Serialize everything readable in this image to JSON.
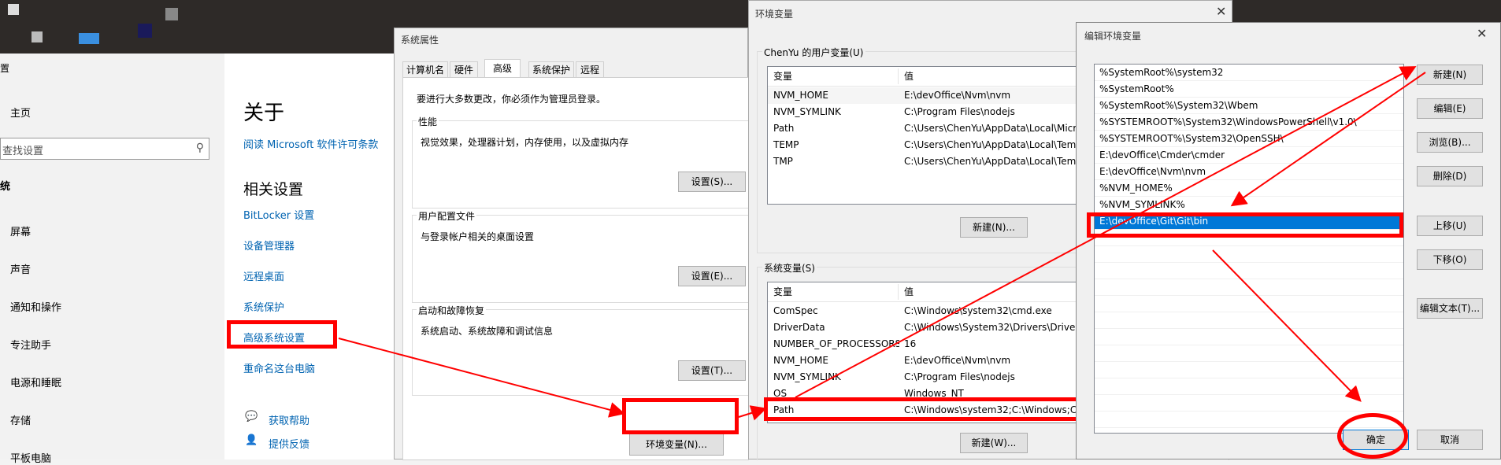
{
  "settings": {
    "header_fragment": "置",
    "home": "主页",
    "search_placeholder": "查找设置",
    "system_fragment": "统",
    "nav": [
      "屏幕",
      "声音",
      "通知和操作",
      "专注助手",
      "电源和睡眠",
      "存储",
      "平板电脑"
    ],
    "about_title": "关于",
    "license_link": "阅读 Microsoft 软件许可条款",
    "related_title": "相关设置",
    "related_links": [
      "BitLocker 设置",
      "设备管理器",
      "远程桌面",
      "系统保护",
      "高级系统设置",
      "重命名这台电脑"
    ],
    "help": "获取帮助",
    "feedback": "提供反馈"
  },
  "sysprops": {
    "title": "系统属性",
    "tabs": [
      "计算机名",
      "硬件",
      "高级",
      "系统保护",
      "远程"
    ],
    "active_tab": "高级",
    "admin_note": "要进行大多数更改，你必须作为管理员登录。",
    "perf_label": "性能",
    "perf_desc": "视觉效果，处理器计划，内存使用，以及虚拟内存",
    "perf_btn": "设置(S)...",
    "profile_label": "用户配置文件",
    "profile_desc": "与登录帐户相关的桌面设置",
    "profile_btn": "设置(E)...",
    "startup_label": "启动和故障恢复",
    "startup_desc": "系统启动、系统故障和调试信息",
    "startup_btn": "设置(T)...",
    "env_btn": "环境变量(N)..."
  },
  "envvars": {
    "title": "环境变量",
    "user_group": "ChenYu 的用户变量(U)",
    "col_var": "变量",
    "col_val": "值",
    "user_rows": [
      {
        "name": "NVM_HOME",
        "value": "E:\\devOffice\\Nvm\\nvm"
      },
      {
        "name": "NVM_SYMLINK",
        "value": "C:\\Program Files\\nodejs"
      },
      {
        "name": "Path",
        "value": "C:\\Users\\ChenYu\\AppData\\Local\\Micro"
      },
      {
        "name": "TEMP",
        "value": "C:\\Users\\ChenYu\\AppData\\Local\\Temp"
      },
      {
        "name": "TMP",
        "value": "C:\\Users\\ChenYu\\AppData\\Local\\Temp"
      }
    ],
    "user_new_btn": "新建(N)...",
    "sys_group": "系统变量(S)",
    "sys_rows": [
      {
        "name": "ComSpec",
        "value": "C:\\Windows\\system32\\cmd.exe"
      },
      {
        "name": "DriverData",
        "value": "C:\\Windows\\System32\\Drivers\\DriverD"
      },
      {
        "name": "NUMBER_OF_PROCESSORS",
        "value": "16"
      },
      {
        "name": "NVM_HOME",
        "value": "E:\\devOffice\\Nvm\\nvm"
      },
      {
        "name": "NVM_SYMLINK",
        "value": "C:\\Program Files\\nodejs"
      },
      {
        "name": "OS",
        "value": "Windows_NT"
      },
      {
        "name": "Path",
        "value": "C:\\Windows\\system32;C:\\Windows;C:\\"
      }
    ],
    "sys_new_btn": "新建(W)..."
  },
  "editenv": {
    "title": "编辑环境变量",
    "entries": [
      "%SystemRoot%\\system32",
      "%SystemRoot%",
      "%SystemRoot%\\System32\\Wbem",
      "%SYSTEMROOT%\\System32\\WindowsPowerShell\\v1.0\\",
      "%SYSTEMROOT%\\System32\\OpenSSH\\",
      "E:\\devOffice\\Cmder\\cmder",
      "E:\\devOffice\\Nvm\\nvm",
      "%NVM_HOME%",
      "%NVM_SYMLINK%",
      "E:\\devOffice\\Git\\Git\\bin"
    ],
    "selected_index": 9,
    "buttons": {
      "new": "新建(N)",
      "edit": "编辑(E)",
      "browse": "浏览(B)...",
      "delete": "删除(D)",
      "up": "上移(U)",
      "down": "下移(O)",
      "edit_text": "编辑文本(T)...",
      "ok": "确定",
      "cancel": "取消"
    }
  },
  "colors": {
    "highlight": "#ff0000",
    "selection": "#0078d7",
    "link": "#0063b1"
  }
}
